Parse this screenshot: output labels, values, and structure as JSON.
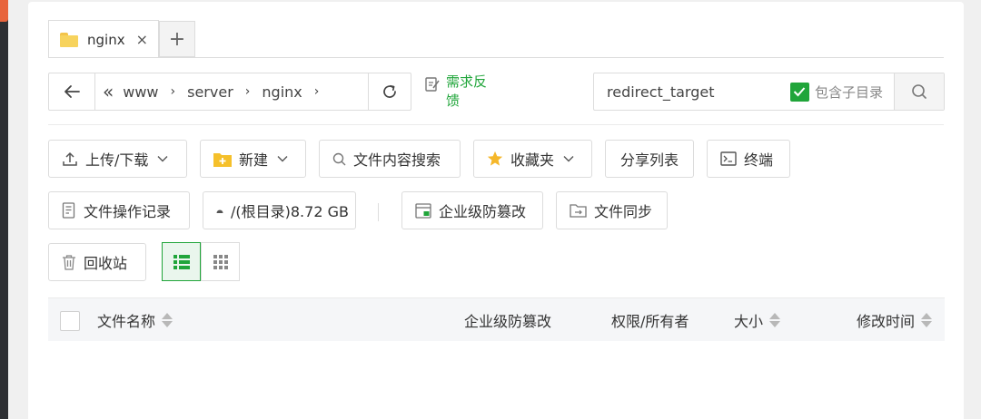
{
  "tabs": [
    {
      "label": "nginx",
      "close": "×"
    }
  ],
  "tab_add": "+",
  "path": {
    "collapse": "«",
    "crumbs": [
      "www",
      "server",
      "nginx"
    ],
    "sep": "›"
  },
  "feedback": "需求反馈",
  "search": {
    "value": "redirect_target",
    "include_subdir_label": "包含子目录",
    "include_subdir_checked": true
  },
  "toolbar": {
    "upload_download": "上传/下载",
    "new": "新建",
    "content_search": "文件内容搜索",
    "favorites": "收藏夹",
    "share_list": "分享列表",
    "terminal": "终端",
    "op_log": "文件操作记录",
    "disk": "/(根目录)8.72 GB",
    "tamper_proof": "企业级防篡改",
    "file_sync": "文件同步",
    "recycle_bin": "回收站"
  },
  "view_mode": "list",
  "table": {
    "headers": {
      "name": "文件名称",
      "tamper": "企业级防篡改",
      "perm_owner": "权限/所有者",
      "size": "大小",
      "mtime": "修改时间"
    }
  },
  "colors": {
    "accent": "#20a53a",
    "folder": "#f7d35d"
  }
}
